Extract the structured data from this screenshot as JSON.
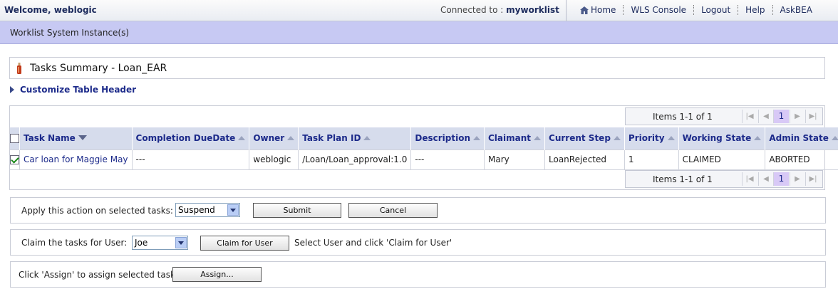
{
  "header": {
    "welcome": "Welcome, weblogic",
    "connected_label": "Connected to :",
    "connected_value": "myworklist",
    "nav": [
      "Home",
      "WLS Console",
      "Logout",
      "Help",
      "AskBEA"
    ]
  },
  "band": {
    "title": "Worklist System Instance(s)"
  },
  "summary": {
    "title": "Tasks Summary - Loan_EAR"
  },
  "customize": {
    "label": "Customize Table Header"
  },
  "pager": {
    "items_text": "Items 1-1 of 1",
    "page": "1"
  },
  "table": {
    "columns": [
      "Task Name",
      "Completion DueDate",
      "Owner",
      "Task Plan ID",
      "Description",
      "Claimant",
      "Current Step",
      "Priority",
      "Working State",
      "Admin State"
    ],
    "rows": [
      {
        "checked": true,
        "task_name": "Car loan for Maggie May",
        "due_date": "---",
        "owner": "weblogic",
        "plan_id": "/Loan/Loan_approval:1.0",
        "description": "---",
        "claimant": "Mary",
        "current_step": "LoanRejected",
        "priority": "1",
        "working_state": "CLAIMED",
        "admin_state": "ABORTED"
      }
    ]
  },
  "actions": {
    "apply_label": "Apply this action on selected tasks:",
    "action_select": "Suspend",
    "submit": "Submit",
    "cancel": "Cancel"
  },
  "claim": {
    "label": "Claim the tasks for User:",
    "user_select": "Joe",
    "button": "Claim for User",
    "hint": "Select User and click 'Claim for User'"
  },
  "assign": {
    "label": "Click 'Assign' to assign selected tasks",
    "button": "Assign..."
  },
  "colors": {
    "accent": "#1c2a8a",
    "band": "#c7c9f3",
    "header_row": "#d6dcec",
    "page_highlight": "#d8c9f6"
  }
}
